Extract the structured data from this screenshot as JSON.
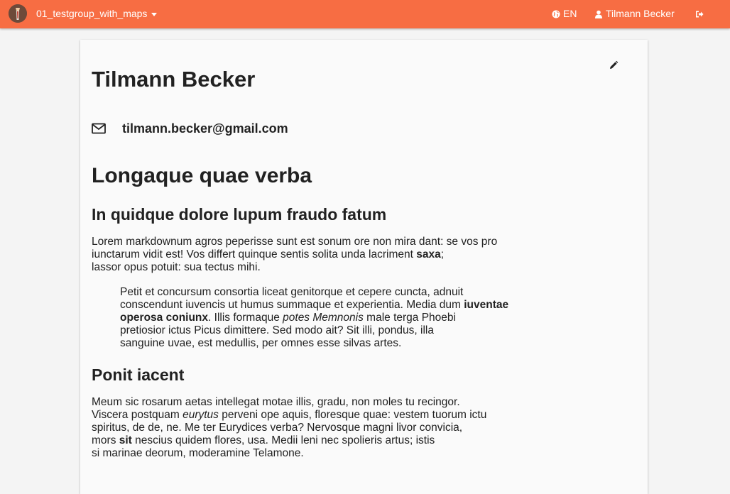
{
  "navbar": {
    "group_label": "01_testgroup_with_maps",
    "lang_label": "EN",
    "user_label": "Tilmann Becker"
  },
  "profile": {
    "name": "Tilmann Becker",
    "email": "tilmann.becker@gmail.com"
  },
  "content": {
    "heading1": "Longaque quae verba",
    "heading2": "In quidque dolore lupum fraudo fatum",
    "p1": {
      "line1": "Lorem markdownum agros peperisse sunt est sonum ore non mira dant: se vos pro",
      "line2a": "iunctarum vidit est! Vos differt quinque sentis solita unda lacriment ",
      "line2b": "saxa",
      "line2c": ";",
      "line3": "lassor opus potuit: sua tectus mihi."
    },
    "quote": {
      "l1": "Petit et concursum consortia liceat genitorque et cepere cuncta, adnuit",
      "l2a": "conscendunt iuvencis ut humus summaque et experientia. Media dum ",
      "l2b": "iuventae",
      "l3a": "operosa coniunx",
      "l3b": ". Illis formaque ",
      "l3c": "potes Memnonis",
      "l3d": " male terga Phoebi",
      "l4": "pretiosior ictus Picus dimittere. Sed modo ait? Sit illi, pondus, illa",
      "l5": "sanguine uvae, est medullis, per omnes esse silvas artes."
    },
    "heading3": "Ponit iacent",
    "p2": {
      "l1": "Meum sic rosarum aetas intellegat motae illis, gradu, non moles tu recingor.",
      "l2a": "Viscera postquam ",
      "l2b": "eurytus",
      "l2c": " perveni ope aquis, floresque quae: vestem tuorum ictu",
      "l3": "spiritus, de de, ne. Me ter Eurydices verba? Nervosque magni livor convicia,",
      "l4a": "mors ",
      "l4b": "sit",
      "l4c": " nescius quidem flores, usa. Medii leni nec spolieris artus; istis",
      "l5": "si marinae deorum, moderamine Telamone."
    }
  },
  "colors": {
    "navbar": "#f76d43",
    "card": "#fafafa",
    "page": "#f4f4f4"
  },
  "icons": {
    "logo": "app-logo-icon",
    "caret": "caret-down-icon",
    "globe": "globe-icon",
    "user": "user-icon",
    "logout": "logout-icon",
    "edit": "pencil-icon",
    "mail": "envelope-icon"
  }
}
